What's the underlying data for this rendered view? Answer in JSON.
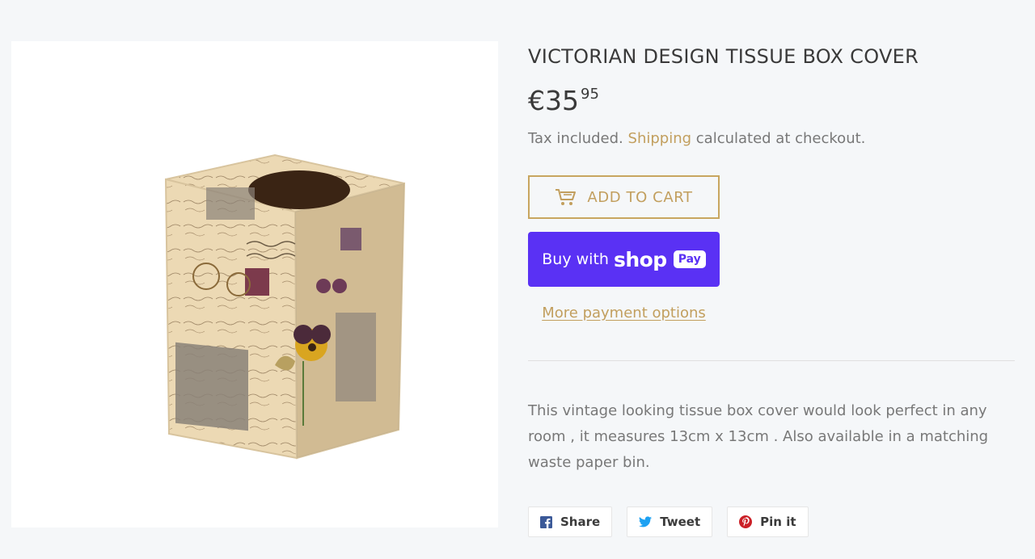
{
  "product": {
    "title": "VICTORIAN DESIGN TISSUE BOX COVER",
    "price_main": "€35",
    "price_cents": "95",
    "tax_prefix": "Tax included. ",
    "shipping_link": "Shipping",
    "tax_suffix": " calculated at checkout.",
    "description": "This vintage looking tissue box cover would look perfect in any room , it measures 13cm x 13cm . Also available in a matching waste paper bin.",
    "image_alt": "Victorian design tissue box cover"
  },
  "buttons": {
    "add_to_cart": "ADD TO CART",
    "buy_with": "Buy with",
    "shop": "shop",
    "pay": "Pay",
    "more_payment": "More payment options"
  },
  "share": [
    {
      "label": "Share",
      "icon": "facebook-icon"
    },
    {
      "label": "Tweet",
      "icon": "twitter-icon"
    },
    {
      "label": "Pin it",
      "icon": "pinterest-icon"
    }
  ],
  "colors": {
    "accent": "#c29f5e",
    "shop_pay": "#5a31f4",
    "facebook": "#3b5998",
    "twitter": "#1da1f2",
    "pinterest": "#cb2027"
  }
}
